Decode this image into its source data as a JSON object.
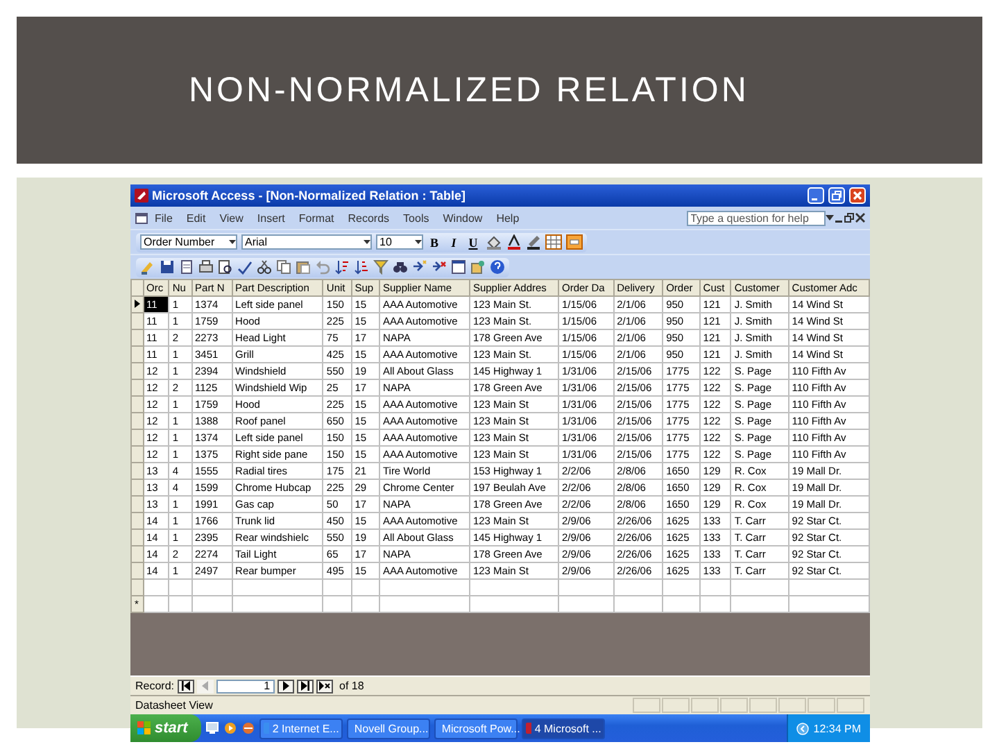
{
  "slide": {
    "title": "NON-NORMALIZED RELATION"
  },
  "window": {
    "title": "Microsoft Access - [Non-Normalized Relation : Table]"
  },
  "menu": [
    "File",
    "Edit",
    "View",
    "Insert",
    "Format",
    "Records",
    "Tools",
    "Window",
    "Help"
  ],
  "help_box": {
    "placeholder": "Type a question for help"
  },
  "format_toolbar": {
    "object": "Order Number",
    "font": "Arial",
    "size": "10",
    "styles": [
      "B",
      "I",
      "U"
    ]
  },
  "table": {
    "columns": [
      "Orc",
      "Nu",
      "Part N",
      "Part Description",
      "Unit",
      "Sup",
      "Supplier Name",
      "Supplier Addres",
      "Order Da",
      "Delivery",
      "Order",
      "Cust",
      "Customer",
      "Customer Adc"
    ],
    "rows": [
      {
        "current": true,
        "cells": [
          "11",
          "1",
          "1374",
          "Left side panel",
          "150",
          "15",
          "AAA Automotive",
          "123 Main St.",
          "1/15/06",
          "2/1/06",
          "950",
          "121",
          "J. Smith",
          "14 Wind St"
        ]
      },
      {
        "current": false,
        "cells": [
          "11",
          "1",
          "1759",
          "Hood",
          "225",
          "15",
          "AAA Automotive",
          "123 Main St.",
          "1/15/06",
          "2/1/06",
          "950",
          "121",
          "J. Smith",
          "14 Wind St"
        ]
      },
      {
        "current": false,
        "cells": [
          "11",
          "2",
          "2273",
          "Head Light",
          "75",
          "17",
          "NAPA",
          "178 Green Ave",
          "1/15/06",
          "2/1/06",
          "950",
          "121",
          "J. Smith",
          "14 Wind St"
        ]
      },
      {
        "current": false,
        "cells": [
          "11",
          "1",
          "3451",
          "Grill",
          "425",
          "15",
          "AAA Automotive",
          "123 Main St.",
          "1/15/06",
          "2/1/06",
          "950",
          "121",
          "J. Smith",
          "14 Wind St"
        ]
      },
      {
        "current": false,
        "cells": [
          "12",
          "1",
          "2394",
          "Windshield",
          "550",
          "19",
          "All About Glass",
          "145 Highway 1",
          "1/31/06",
          "2/15/06",
          "1775",
          "122",
          "S. Page",
          "110 Fifth Av"
        ]
      },
      {
        "current": false,
        "cells": [
          "12",
          "2",
          "1125",
          "Windshield Wip",
          "25",
          "17",
          "NAPA",
          "178 Green Ave",
          "1/31/06",
          "2/15/06",
          "1775",
          "122",
          "S. Page",
          "110 Fifth Av"
        ]
      },
      {
        "current": false,
        "cells": [
          "12",
          "1",
          "1759",
          "Hood",
          "225",
          "15",
          "AAA Automotive",
          "123 Main St",
          "1/31/06",
          "2/15/06",
          "1775",
          "122",
          "S. Page",
          "110 Fifth Av"
        ]
      },
      {
        "current": false,
        "cells": [
          "12",
          "1",
          "1388",
          "Roof panel",
          "650",
          "15",
          "AAA Automotive",
          "123 Main St",
          "1/31/06",
          "2/15/06",
          "1775",
          "122",
          "S. Page",
          "110 Fifth Av"
        ]
      },
      {
        "current": false,
        "cells": [
          "12",
          "1",
          "1374",
          "Left side panel",
          "150",
          "15",
          "AAA Automotive",
          "123 Main St",
          "1/31/06",
          "2/15/06",
          "1775",
          "122",
          "S. Page",
          "110 Fifth Av"
        ]
      },
      {
        "current": false,
        "cells": [
          "12",
          "1",
          "1375",
          "Right side pane",
          "150",
          "15",
          "AAA Automotive",
          "123 Main St",
          "1/31/06",
          "2/15/06",
          "1775",
          "122",
          "S. Page",
          "110 Fifth Av"
        ]
      },
      {
        "current": false,
        "cells": [
          "13",
          "4",
          "1555",
          "Radial tires",
          "175",
          "21",
          "Tire World",
          "153 Highway 1",
          "2/2/06",
          "2/8/06",
          "1650",
          "129",
          "R. Cox",
          "19 Mall Dr."
        ]
      },
      {
        "current": false,
        "cells": [
          "13",
          "4",
          "1599",
          "Chrome Hubcap",
          "225",
          "29",
          "Chrome Center",
          "197 Beulah Ave",
          "2/2/06",
          "2/8/06",
          "1650",
          "129",
          "R. Cox",
          "19 Mall Dr."
        ]
      },
      {
        "current": false,
        "cells": [
          "13",
          "1",
          "1991",
          "Gas cap",
          "50",
          "17",
          "NAPA",
          "178 Green Ave",
          "2/2/06",
          "2/8/06",
          "1650",
          "129",
          "R. Cox",
          "19 Mall Dr."
        ]
      },
      {
        "current": false,
        "cells": [
          "14",
          "1",
          "1766",
          "Trunk lid",
          "450",
          "15",
          "AAA Automotive",
          "123 Main St",
          "2/9/06",
          "2/26/06",
          "1625",
          "133",
          "T. Carr",
          "92 Star Ct."
        ]
      },
      {
        "current": false,
        "cells": [
          "14",
          "1",
          "2395",
          "Rear windshielc",
          "550",
          "19",
          "All About Glass",
          "145 Highway 1",
          "2/9/06",
          "2/26/06",
          "1625",
          "133",
          "T. Carr",
          "92 Star Ct."
        ]
      },
      {
        "current": false,
        "cells": [
          "14",
          "2",
          "2274",
          "Tail Light",
          "65",
          "17",
          "NAPA",
          "178 Green Ave",
          "2/9/06",
          "2/26/06",
          "1625",
          "133",
          "T. Carr",
          "92 Star Ct."
        ]
      },
      {
        "current": false,
        "cells": [
          "14",
          "1",
          "2497",
          "Rear bumper",
          "495",
          "15",
          "AAA Automotive",
          "123 Main St",
          "2/9/06",
          "2/26/06",
          "1625",
          "133",
          "T. Carr",
          "92 Star Ct."
        ]
      }
    ],
    "new_row_marker": "*"
  },
  "record_nav": {
    "label": "Record:",
    "value": "1",
    "total": "of 18"
  },
  "status_bar": {
    "text": "Datasheet View"
  },
  "taskbar": {
    "start": "start",
    "buttons": [
      {
        "label": "2 Internet E...",
        "selected": false
      },
      {
        "label": "Novell Group...",
        "selected": false
      },
      {
        "label": "Microsoft Pow...",
        "selected": false
      },
      {
        "label": "4 Microsoft ...",
        "selected": true
      }
    ],
    "clock": "12:34 PM"
  }
}
